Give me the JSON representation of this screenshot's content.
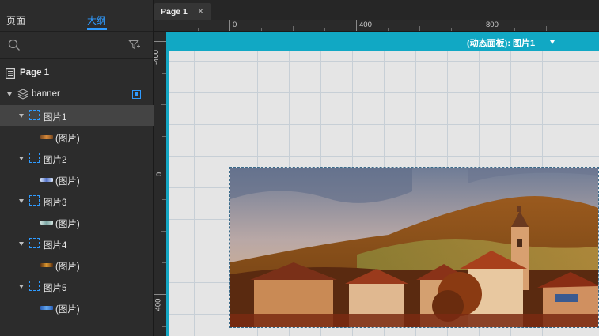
{
  "left_panel": {
    "tabs": [
      {
        "label": "页面",
        "active": false
      },
      {
        "label": "大纲",
        "active": true
      }
    ],
    "tree": {
      "page": {
        "label": "Page 1"
      },
      "group": {
        "label": "banner"
      },
      "items": [
        {
          "label": "图片1",
          "child": "(图片)",
          "thumb_color": "#c7773a"
        },
        {
          "label": "图片2",
          "child": "(图片)",
          "thumb_color": "#5b7bd0"
        },
        {
          "label": "图片3",
          "child": "(图片)",
          "thumb_color": "#8ab0b0"
        },
        {
          "label": "图片4",
          "child": "(图片)",
          "thumb_color": "#d08a2a"
        },
        {
          "label": "图片5",
          "child": "(图片)",
          "thumb_color": "#4f8ee0"
        }
      ]
    }
  },
  "editor": {
    "tab": {
      "label": "Page 1",
      "close": "×"
    },
    "ruler_h": [
      "0",
      "400",
      "800"
    ],
    "ruler_v": [
      "-400",
      "0",
      "400"
    ],
    "dynamic_panel_label": "(动态面板):  图片1"
  },
  "colors": {
    "accent": "#2f9bff",
    "panel_bar": "#11a8c4"
  }
}
